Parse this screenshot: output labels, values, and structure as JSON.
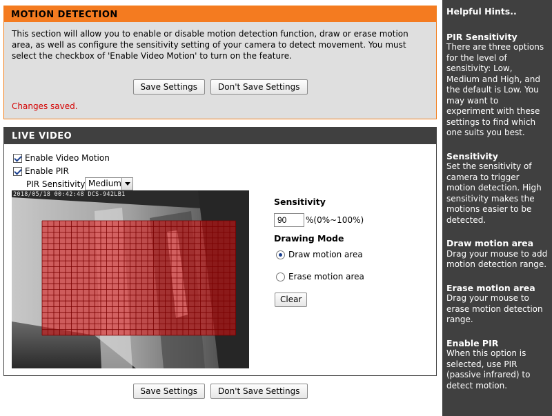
{
  "motion_detection": {
    "title": "MOTION DETECTION",
    "description": "This section will allow you to enable or disable motion detection function, draw or erase motion area, as well as configure the sensitivity setting of your camera to detect movement. You must select the checkbox of 'Enable Video Motion' to turn on the feature.",
    "save_label": "Save Settings",
    "dont_save_label": "Don't Save Settings",
    "status": "Changes saved.",
    "status_color": "#d40000"
  },
  "live_video": {
    "title": "LIVE VIDEO",
    "enable_video_motion": {
      "label": "Enable Video Motion",
      "checked": true
    },
    "enable_pir": {
      "label": "Enable PIR",
      "checked": true
    },
    "pir_sensitivity": {
      "label": "PIR Sensitivity",
      "selected": "Medium"
    },
    "timestamp": "2018/05/18 00:42:48 DCS-942LB1",
    "sensitivity": {
      "title": "Sensitivity",
      "value": "90",
      "range": "%(0%~100%)"
    },
    "drawing_mode": {
      "title": "Drawing Mode",
      "options": [
        {
          "label": "Draw motion area",
          "selected": true
        },
        {
          "label": "Erase motion area",
          "selected": false
        }
      ]
    },
    "clear_label": "Clear",
    "motion_area_color": "#e01010"
  },
  "bottom_buttons": {
    "save_label": "Save Settings",
    "dont_save_label": "Don't Save Settings"
  },
  "hints": {
    "title": "Helpful Hints..",
    "items": [
      {
        "heading": "PIR Sensitivity",
        "text": "There are three options for the level of sensitivity: Low, Medium and High, and the default is Low. You may want to experiment with these settings to find which one suits you best."
      },
      {
        "heading": "Sensitivity",
        "text": "Set the sensitivity of camera to trigger motion detection. High sensitivity makes the motions easier to be detected."
      },
      {
        "heading": "Draw motion area",
        "text": "Drag your mouse to add motion detection range."
      },
      {
        "heading": "Erase motion area",
        "text": "Drag your mouse to erase motion detection range."
      },
      {
        "heading": "Enable PIR",
        "text": "When this option is selected, use PIR (passive infrared) to detect motion."
      }
    ]
  },
  "colors": {
    "accent_orange": "#f47b20",
    "dark_header": "#404040",
    "panel_gray": "#dfdfdf"
  }
}
